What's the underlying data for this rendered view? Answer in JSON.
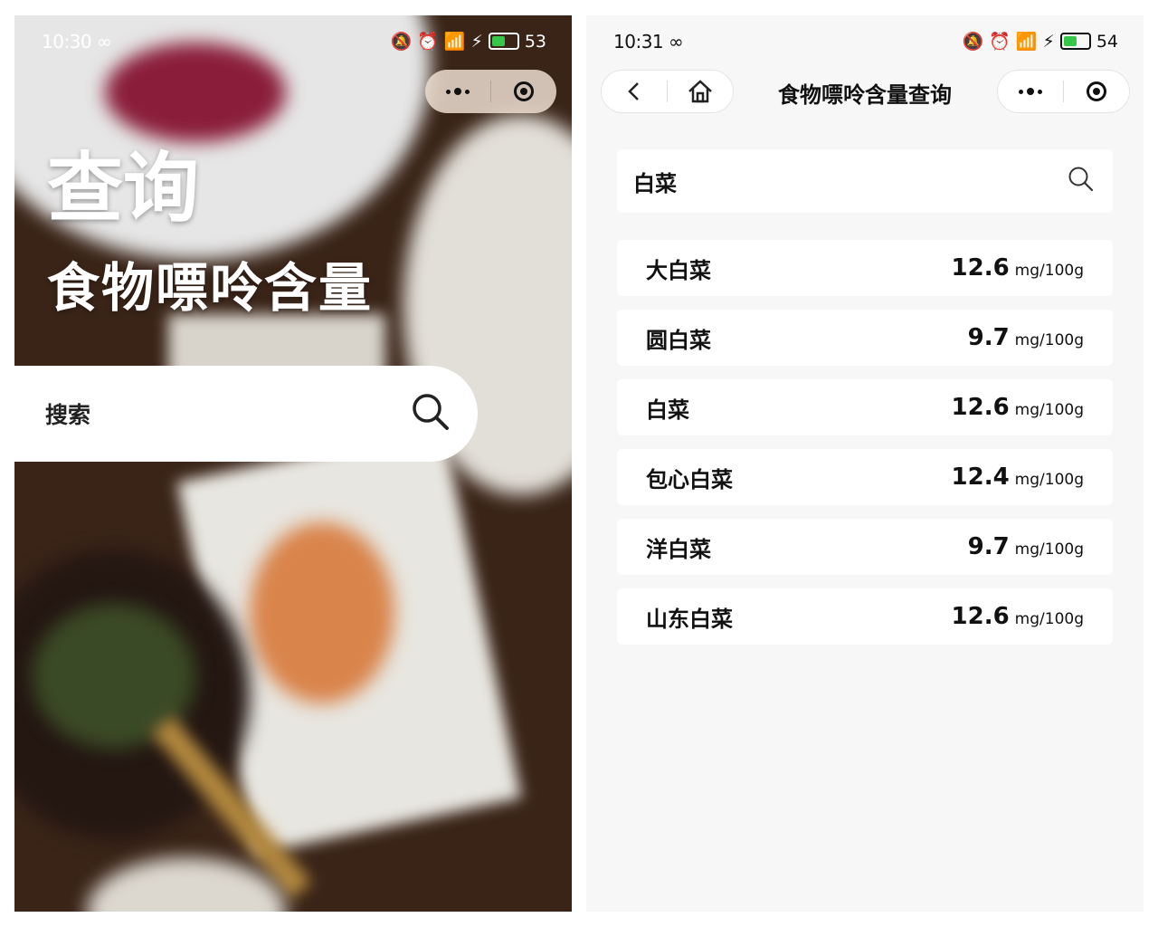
{
  "left": {
    "status": {
      "time": "10:30",
      "loop": "∞",
      "battery": "53"
    },
    "hero": {
      "title": "查询",
      "subtitle": "食物嘌呤含量"
    },
    "search": {
      "label": "搜索"
    }
  },
  "right": {
    "status": {
      "time": "10:31",
      "loop": "∞",
      "battery": "54"
    },
    "nav": {
      "title": "食物嘌呤含量查询"
    },
    "search": {
      "value": "白菜"
    },
    "results": [
      {
        "name": "大白菜",
        "value": "12.6",
        "unit": "mg/100g"
      },
      {
        "name": "圆白菜",
        "value": "9.7",
        "unit": "mg/100g"
      },
      {
        "name": "白菜",
        "value": "12.6",
        "unit": "mg/100g"
      },
      {
        "name": "包心白菜",
        "value": "12.4",
        "unit": "mg/100g"
      },
      {
        "name": "洋白菜",
        "value": "9.7",
        "unit": "mg/100g"
      },
      {
        "name": "山东白菜",
        "value": "12.6",
        "unit": "mg/100g"
      }
    ]
  },
  "colors": {
    "battery_fill": "#35c64a",
    "right_bg": "#f7f7f7",
    "search_bg": "#ffffff"
  }
}
